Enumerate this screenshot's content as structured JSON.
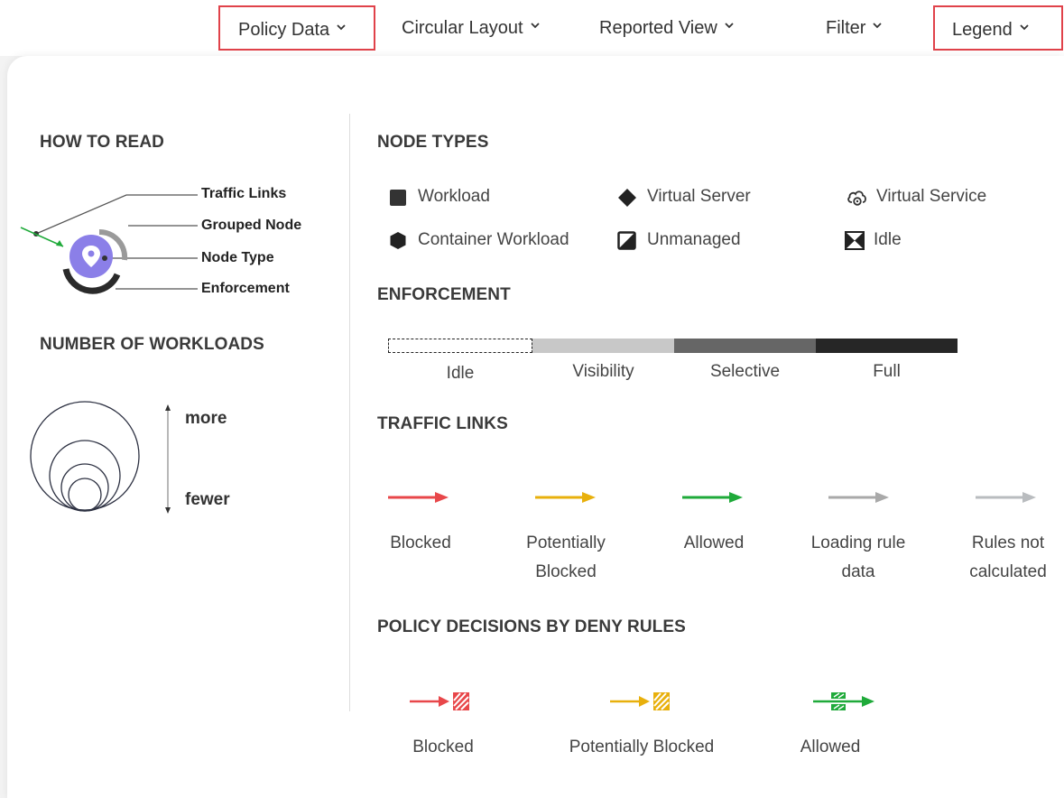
{
  "toolbar": {
    "items": [
      {
        "label": "Policy Data",
        "highlighted": true
      },
      {
        "label": "Circular Layout",
        "highlighted": false
      },
      {
        "label": "Reported View",
        "highlighted": false
      },
      {
        "label": "Filter",
        "highlighted": false
      },
      {
        "label": "Legend",
        "highlighted": true
      }
    ],
    "highlight_color": "#e0424a"
  },
  "how_to_read": {
    "title": "HOW TO READ",
    "labels": [
      "Traffic Links",
      "Grouped Node",
      "Node Type",
      "Enforcement"
    ],
    "node_color": "#8b7fe8"
  },
  "number_of_workloads": {
    "title": "NUMBER OF WORKLOADS",
    "more": "more",
    "fewer": "fewer"
  },
  "node_types": {
    "title": "NODE TYPES",
    "items": [
      {
        "label": "Workload",
        "icon": "square-icon"
      },
      {
        "label": "Virtual Server",
        "icon": "diamond-icon"
      },
      {
        "label": "Virtual Service",
        "icon": "virtual-service-icon"
      },
      {
        "label": "Container Workload",
        "icon": "hexagon-icon"
      },
      {
        "label": "Unmanaged",
        "icon": "half-square-icon"
      },
      {
        "label": "Idle",
        "icon": "idle-hourglass-icon"
      }
    ]
  },
  "enforcement": {
    "title": "ENFORCEMENT",
    "levels": [
      {
        "label": "Idle",
        "color": "#ffffff"
      },
      {
        "label": "Visibility",
        "color": "#c8c8c8"
      },
      {
        "label": "Selective",
        "color": "#666666"
      },
      {
        "label": "Full",
        "color": "#262626"
      }
    ]
  },
  "traffic_links": {
    "title": "TRAFFIC LINKS",
    "items": [
      {
        "label": "Blocked",
        "color": "#e8474a"
      },
      {
        "label": "Potentially Blocked",
        "color": "#e8b00c"
      },
      {
        "label": "Allowed",
        "color": "#1faa3a"
      },
      {
        "label": "Loading rule data",
        "color": "#a9a9a9"
      },
      {
        "label": "Rules not calculated",
        "color": "#b9bcbf"
      }
    ]
  },
  "policy_decisions": {
    "title": "POLICY DECISIONS BY DENY RULES",
    "items": [
      {
        "label": "Blocked",
        "color": "#e8474a"
      },
      {
        "label": "Potentially Blocked",
        "color": "#e8b00c"
      },
      {
        "label": "Allowed",
        "color": "#1faa3a"
      }
    ]
  }
}
